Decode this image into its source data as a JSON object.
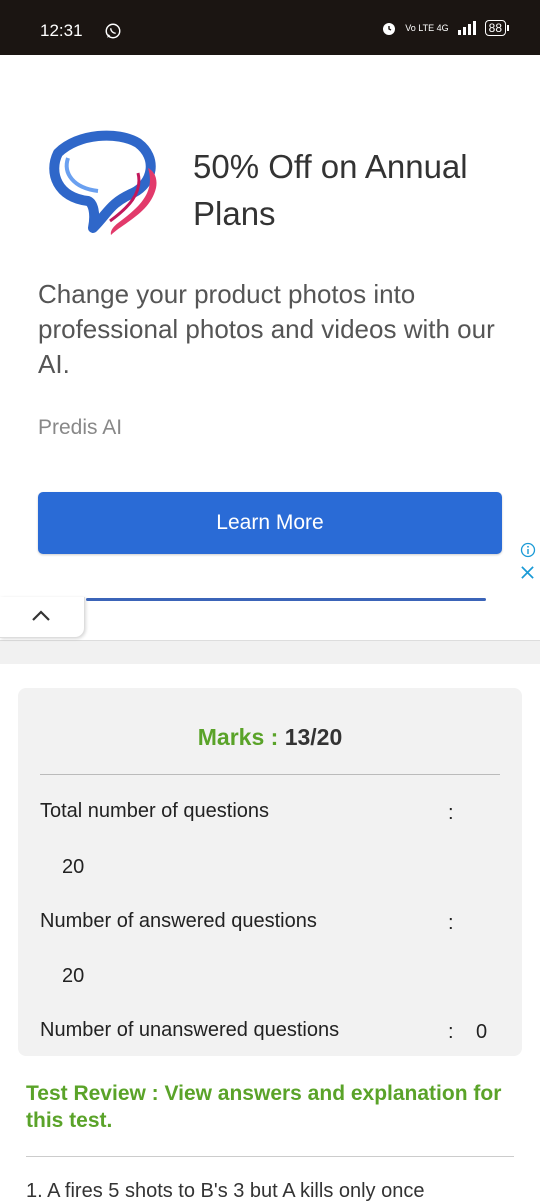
{
  "status_bar": {
    "time": "12:31",
    "network": "Vo LTE 4G",
    "battery": "88"
  },
  "ad": {
    "headline": "50% Off on Annual Plans",
    "body": "Change your product photos into professional photos and videos with our AI.",
    "advertiser": "Predis AI",
    "cta_label": "Learn More",
    "cta_color": "#2a6bd6",
    "info_icon": "info-icon",
    "close_icon": "close-icon"
  },
  "collapse": {
    "icon": "chevron-up-icon"
  },
  "result": {
    "marks_label": "Marks : ",
    "marks_value": "13/20",
    "stats": [
      {
        "label": "Total number of questions",
        "colon": ":",
        "value": "20"
      },
      {
        "label": "Number of answered questions",
        "colon": ":",
        "value": "20"
      },
      {
        "label": "Number of unanswered questions",
        "colon": ":",
        "value": "0"
      }
    ]
  },
  "review": {
    "text": "Test Review : View answers and explanation for this test."
  },
  "question": {
    "text": "1. A fires 5 shots to B's 3 but A kills only once"
  },
  "colors": {
    "accent_green": "#5aa329",
    "status_bar": "#1b1512"
  }
}
